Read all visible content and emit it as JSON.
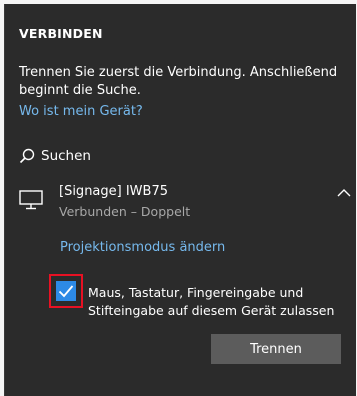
{
  "panel": {
    "title": "VERBINDEN",
    "description": "Trennen Sie zuerst die Verbindung. Anschließend beginnt die Suche.",
    "where_link": "Wo ist mein Gerät?",
    "search_label": "Suchen"
  },
  "device": {
    "name": "[Signage] IWB75",
    "status": "Verbunden – Doppelt",
    "projection_link": "Projektionsmodus ändern",
    "checkbox_checked": true,
    "checkbox_label": "Maus, Tastatur, Fingereingabe und Stifteingabe auf diesem Gerät zulassen",
    "disconnect_label": "Trennen"
  },
  "icons": {
    "search": "search-icon",
    "monitor": "monitor-icon",
    "chevron": "chevron-up-icon",
    "check": "checkmark-icon"
  },
  "colors": {
    "panel_bg": "#2b2b2b",
    "link": "#76b9ed",
    "checkbox_accent": "#2d8ae6",
    "highlight_border": "#e81123",
    "button_bg": "#5c5c5c"
  }
}
